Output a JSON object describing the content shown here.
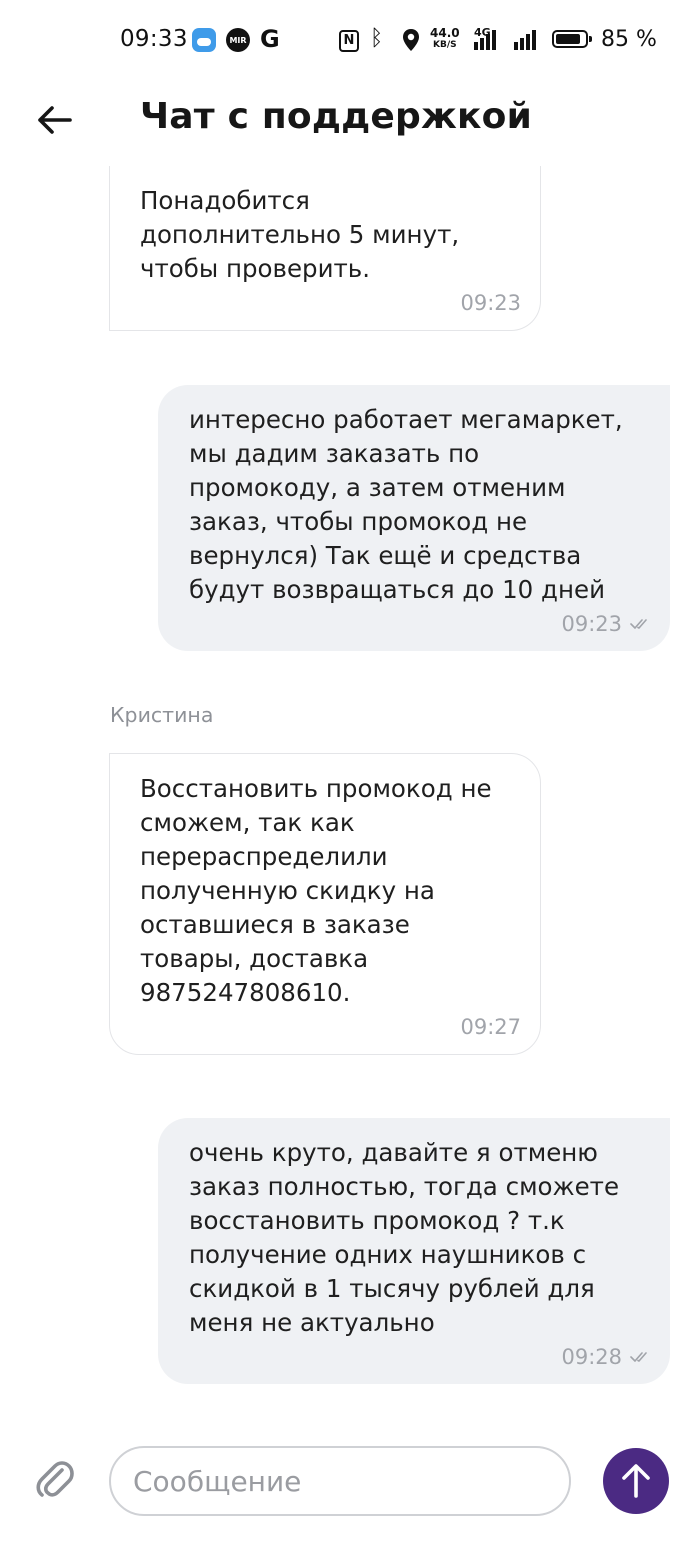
{
  "status_bar": {
    "time": "09:33",
    "app_icons": [
      "weather-icon",
      "mir-icon",
      "google-icon"
    ],
    "mir_label": "MIR",
    "google_label": "G",
    "nfc_label": "N",
    "network_speed": "44.0",
    "network_speed_unit": "KB/S",
    "network_type": "4G",
    "battery_percent": "85 %",
    "battery_level": 0.85
  },
  "header": {
    "title": "Чат с поддержкой",
    "back_icon": "arrow-left-icon"
  },
  "messages": [
    {
      "direction": "incoming",
      "text": "Понадобится\nдополнительно 5 минут,\nчтобы проверить.",
      "time": "09:23"
    },
    {
      "direction": "outgoing",
      "text": "интересно работает мегамаркет,\nмы дадим заказать по\nпромокоду, а затем отменим\nзаказ, чтобы промокод не\nвернулся) Так ещё и средства\nбудут возвращаться до 10 дней",
      "time": "09:23",
      "status_icon": "double-check-icon"
    },
    {
      "direction": "incoming",
      "sender": "Кристина",
      "text": "Восстановить промокод не\nсможем, так как\nперераспределили\nполученную скидку на\nоставшиеся в заказе\nтовары, доставка\n9875247808610.",
      "time": "09:27"
    },
    {
      "direction": "outgoing",
      "text": "очень круто, давайте я отменю\nзаказ полностью, тогда сможете\nвосстановить промокод ? т.к\nполучение одних наушников с\nскидкой в 1 тысячу рублей для\nменя не актуально",
      "time": "09:28",
      "status_icon": "double-check-icon"
    }
  ],
  "composer": {
    "placeholder": "Сообщение",
    "value": "",
    "attach_icon": "paperclip-icon",
    "send_icon": "arrow-up-icon"
  },
  "colors": {
    "accent": "#4b2a83",
    "outgoing_bubble": "#eff1f4",
    "incoming_border": "#e4e5e8",
    "meta_text": "#a1a4aa"
  }
}
